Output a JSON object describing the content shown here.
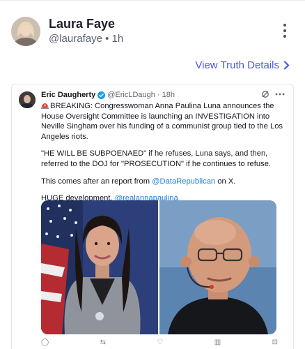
{
  "post": {
    "author_name": "Laura Faye",
    "handle": "@laurafaye",
    "separator": "•",
    "time": "1h",
    "details_link": "View Truth Details",
    "icons": {
      "more": "more-vertical-icon",
      "chevron": "chevron-right-icon"
    }
  },
  "embed": {
    "author_name": "Eric Daugherty",
    "handle": "@EricLDaugh",
    "separator": "·",
    "time": "18h",
    "paragraph_1": "BREAKING: Congresswoman Anna Paulina Luna announces the House Oversight Committee is launching an INVESTIGATION into Neville Singham over his funding of a communist group tied to the Los Angeles riots.",
    "paragraph_2": "\"HE WILL BE SUBPOENAED\" if he refuses, Luna says, and then, referred to the DOJ for \"PROSECUTION\" if he continues to refuse.",
    "paragraph_3_prefix": "This comes after an report from ",
    "paragraph_3_mention": "@DataRepublican",
    "paragraph_3_suffix": " on X.",
    "paragraph_4_prefix": "HUGE development. ",
    "paragraph_4_mention": "@realannapaulina",
    "icons": [
      "verified-badge-icon",
      "siren-icon",
      "grok-icon",
      "ellipsis-icon"
    ]
  },
  "colors": {
    "link": "#4a5adb",
    "mention": "#1d80d9",
    "text": "#1d1f2b",
    "muted": "#5b5f73",
    "verified": "#1d9bf0"
  }
}
